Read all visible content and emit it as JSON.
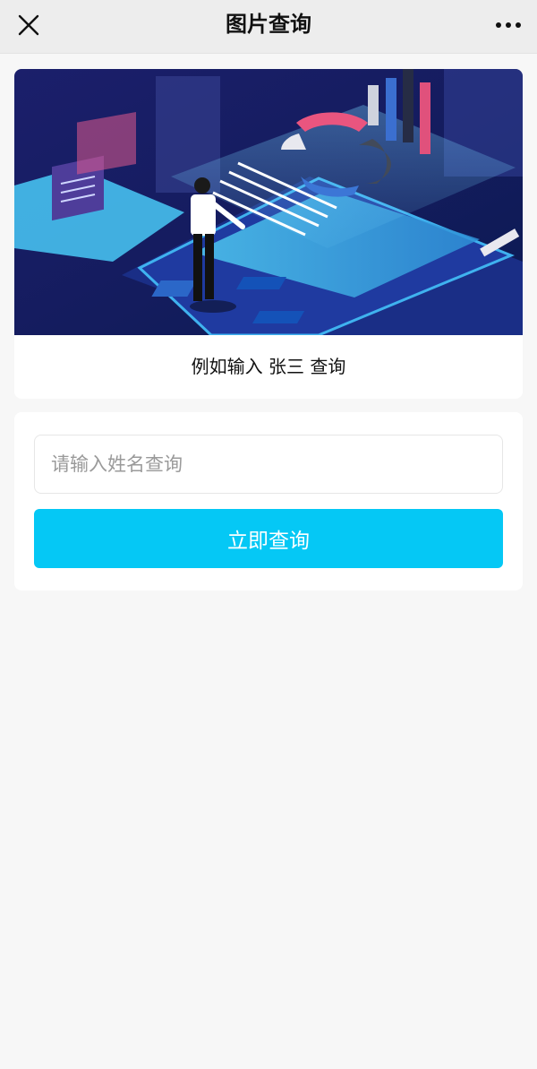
{
  "header": {
    "title": "图片查询",
    "close_icon": "close-icon",
    "more_icon": "more-icon"
  },
  "banner": {
    "hint": "例如输入 张三 查询"
  },
  "search": {
    "placeholder": "请输入姓名查询",
    "value": "",
    "button_label": "立即查询"
  },
  "colors": {
    "accent": "#05c8f5",
    "page_background": "#f7f7f7",
    "topbar_background": "#ededed"
  }
}
